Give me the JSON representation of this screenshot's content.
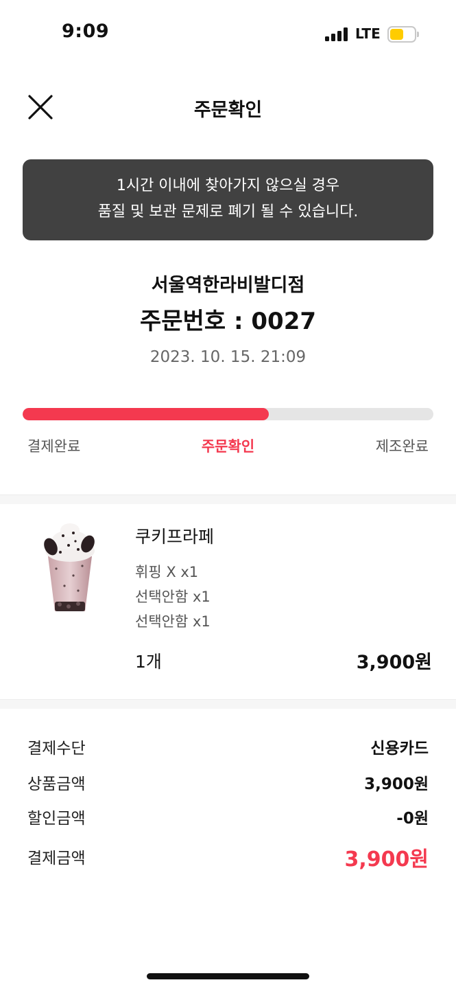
{
  "status_bar": {
    "time": "9:09",
    "network": "LTE",
    "battery_color": "#ffcc00"
  },
  "header": {
    "title": "주문확인",
    "close_icon": "close-icon"
  },
  "notice": {
    "line1": "1시간 이내에 찾아가지 않으실 경우",
    "line2": "품질 및 보관 문제로 폐기 될 수 있습니다."
  },
  "order": {
    "store_name": "서울역한라비발디점",
    "number_text": "주문번호 : 0027",
    "datetime": "2023. 10. 15. 21:09"
  },
  "progress": {
    "fraction": 0.6,
    "accent_color": "#f4394f",
    "steps": [
      "결제완료",
      "주문확인",
      "제조완료"
    ],
    "current_step": "주문확인"
  },
  "product": {
    "name": "쿠키프라페",
    "options": [
      "휘핑 X x1",
      "선택안함 x1",
      "선택안함 x1"
    ],
    "quantity": "1개",
    "price": "3,900원"
  },
  "payment": {
    "method_label": "결제수단",
    "method_value": "신용카드",
    "subtotal_label": "상품금액",
    "subtotal_value": "3,900원",
    "discount_label": "할인금액",
    "discount_value": "-0원",
    "total_label": "결제금액",
    "total_value": "3,900원"
  }
}
